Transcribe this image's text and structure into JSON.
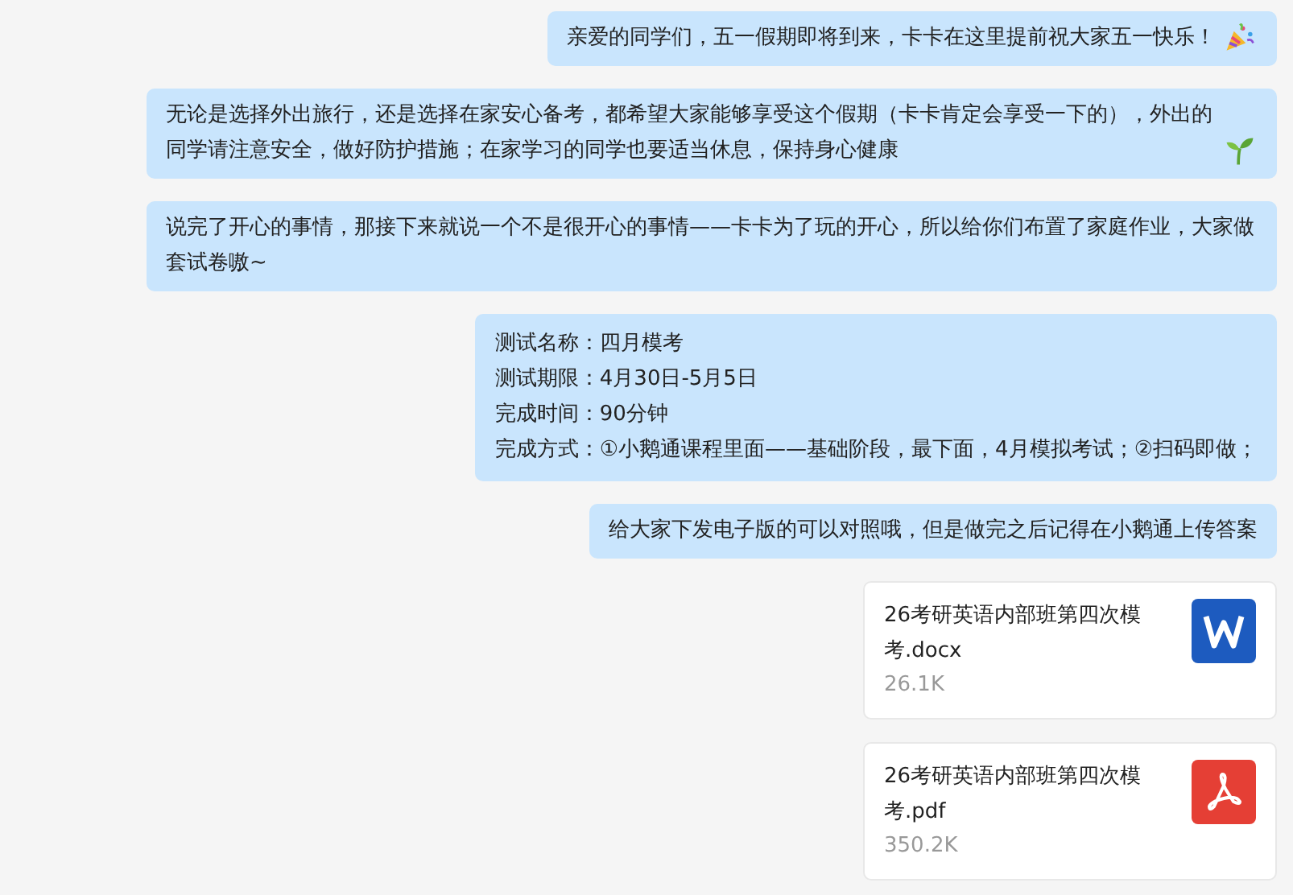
{
  "messages": [
    {
      "kind": "text",
      "text": "亲爱的同学们，五一假期即将到来，卡卡在这里提前祝大家五一快乐！",
      "emoji": {
        "kind": "party"
      }
    },
    {
      "kind": "text",
      "text": "无论是选择外出旅行，还是选择在家安心备考，都希望大家能够享受这个假期（卡卡肯定会享受一下的），外出的同学请注意安全，做好防护措施；在家学习的同学也要适当休息，保持身心健康",
      "emoji": {
        "kind": "sprout"
      }
    },
    {
      "kind": "text",
      "text": "说完了开心的事情，那接下来就说一个不是很开心的事情——卡卡为了玩的开心，所以给你们布置了家庭作业，大家做套试卷嗷~"
    },
    {
      "kind": "fields",
      "fields": [
        {
          "label": "测试名称：",
          "value": "四月模考"
        },
        {
          "label": "测试期限：",
          "value": "4月30日-5月5日"
        },
        {
          "label": "完成时间：",
          "value": "90分钟"
        },
        {
          "label": "完成方式：",
          "value": "①小鹅通课程里面——基础阶段，最下面，4月模拟考试；②扫码即做；"
        }
      ]
    },
    {
      "kind": "text",
      "text": "给大家下发电子版的可以对照哦，但是做完之后记得在小鹅通上传答案"
    },
    {
      "kind": "file",
      "name": "26考研英语内部班第四次模考.docx",
      "size": "26.1K",
      "icon": {
        "kind": "word"
      }
    },
    {
      "kind": "file",
      "name": "26考研英语内部班第四次模考.pdf",
      "size": "350.2K",
      "icon": {
        "kind": "pdf"
      }
    }
  ]
}
